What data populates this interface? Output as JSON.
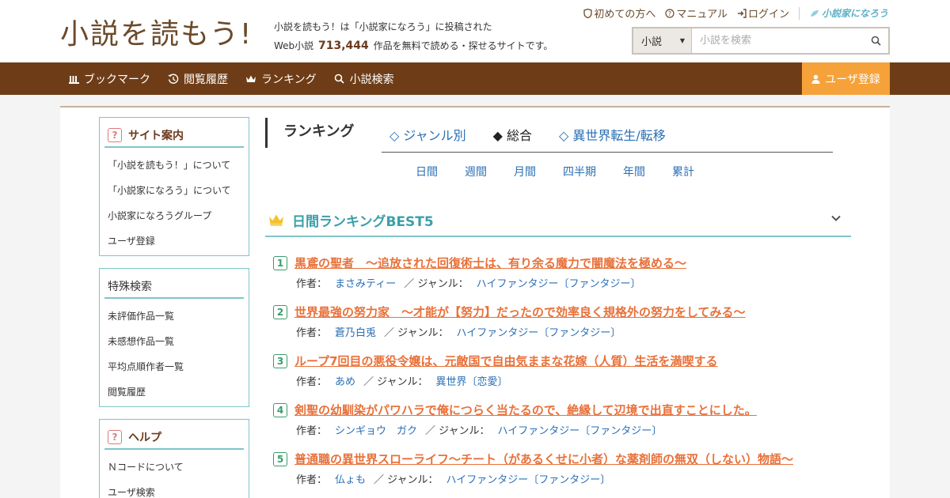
{
  "header": {
    "logo_text": "小説を読もう!",
    "tagline_line1": "小説を読もう！は「小説家になろう」に投稿された",
    "tagline_prefix": "Web小説",
    "work_count": "713,444",
    "tagline_suffix": "作品を無料で読める・探せるサイトです。",
    "top_links": {
      "first_time": "初めての方へ",
      "manual": "マニュアル",
      "login": "ログイン",
      "narou_logo": "小説家になろう"
    },
    "search": {
      "select_value": "小説",
      "placeholder": "小説を検索"
    }
  },
  "nav": {
    "items": [
      {
        "label": "ブックマーク",
        "icon": "bookshelf-icon"
      },
      {
        "label": "閲覧履歴",
        "icon": "history-icon"
      },
      {
        "label": "ランキング",
        "icon": "crown-icon"
      },
      {
        "label": "小説検索",
        "icon": "search-icon"
      }
    ],
    "register_label": "ユーザ登録"
  },
  "sidebar": {
    "site_guide": {
      "title": "サイト案内",
      "items": [
        "「小説を読もう！」について",
        "「小説家になろう」について",
        "小説家になろうグループ",
        "ユーザ登録"
      ]
    },
    "special_search": {
      "title": "特殊検索",
      "items": [
        "未評価作品一覧",
        "未感想作品一覧",
        "平均点順作者一覧",
        "閲覧履歴"
      ]
    },
    "help": {
      "title": "ヘルプ",
      "items": [
        "Ｎコードについて",
        "ユーザ検索"
      ]
    }
  },
  "ranking": {
    "heading": "ランキング",
    "tabs": [
      "◇ ジャンル別",
      "◆ 総合",
      "◇ 異世界転生/転移"
    ],
    "active_tab": 1,
    "periods": [
      "日間",
      "週間",
      "月間",
      "四半期",
      "年間",
      "累計"
    ],
    "best5_title": "日間ランキングBEST5",
    "author_label": "作者：",
    "genre_label": "／ ジャンル：",
    "items": [
      {
        "rank": "1",
        "title": "黒鳶の聖者　～追放された回復術士は、有り余る魔力で闇魔法を極める～",
        "author": "まさみティー",
        "genre": "ハイファンタジー〔ファンタジー〕"
      },
      {
        "rank": "2",
        "title": "世界最強の努力家　～才能が【努力】だったので効率良く規格外の努力をしてみる～",
        "author": "蒼乃白兎",
        "genre": "ハイファンタジー〔ファンタジー〕"
      },
      {
        "rank": "3",
        "title": "ループ7回目の悪役令嬢は、元敵国で自由気ままな花嫁（人質）生活を満喫する",
        "author": "あめ",
        "genre": "異世界〔恋愛〕"
      },
      {
        "rank": "4",
        "title": "剣聖の幼馴染がパワハラで俺につらく当たるので、絶縁して辺境で出直すことにした。",
        "author": "シンギョウ　ガク",
        "genre": "ハイファンタジー〔ファンタジー〕"
      },
      {
        "rank": "5",
        "title": "普通職の異世界スローライフ～チート（があるくせに小者）な薬剤師の無双（しない）物語～",
        "author": "仏ょも",
        "genre": "ハイファンタジー〔ファンタジー〕"
      }
    ]
  },
  "colors": {
    "brand_brown": "#6e3d17",
    "accent_orange": "#f5a23a",
    "teal": "#7fc4c9",
    "title_orange": "#e8713a",
    "link_blue": "#2a6fb5"
  }
}
